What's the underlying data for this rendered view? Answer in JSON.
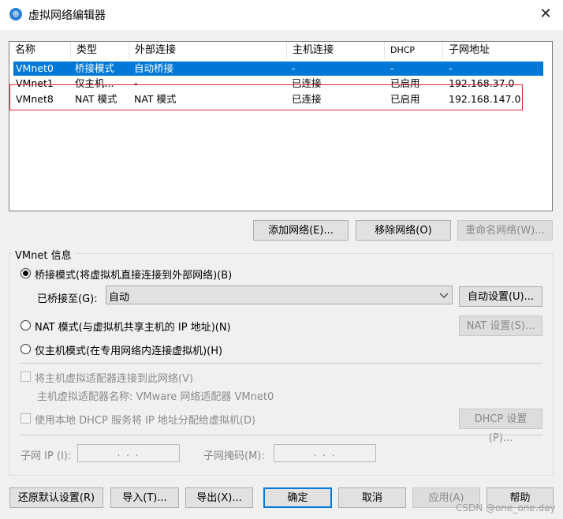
{
  "window": {
    "title": "虚拟网络编辑器",
    "close_glyph": "✕",
    "app_icon_glyph": "⊕"
  },
  "table": {
    "columns": [
      "名称",
      "类型",
      "外部连接",
      "主机连接",
      "DHCP",
      "子网地址"
    ],
    "rows": [
      [
        "VMnet0",
        "桥接模式",
        "自动桥接",
        "-",
        "-",
        "-"
      ],
      [
        "VMnet1",
        "仅主机...",
        "-",
        "已连接",
        "已启用",
        "192.168.37.0"
      ],
      [
        "VMnet8",
        "NAT 模式",
        "NAT 模式",
        "已连接",
        "已启用",
        "192.168.147.0"
      ]
    ],
    "selected_row": 0,
    "highlight_color": "#e0282d",
    "selection_color": "#0078d7"
  },
  "table_buttons": {
    "add": "添加网络(E)...",
    "remove": "移除网络(O)",
    "rename": "重命名网络(W)..."
  },
  "vmnet_info": {
    "group_label": "VMnet 信息",
    "bridged_label": "桥接模式(将虚拟机直接连接到外部网络)(B)",
    "bridged_to_label": "已桥接至(G):",
    "bridged_to_value": "自动",
    "auto_settings": "自动设置(U)...",
    "nat_label": "NAT 模式(与虚拟机共享主机的 IP 地址)(N)",
    "nat_settings": "NAT 设置(S)...",
    "hostonly_label": "仅主机模式(在专用网络内连接虚拟机)(H)",
    "connect_adapter_label": "将主机虚拟适配器连接到此网络(V)",
    "adapter_name_label": "主机虚拟适配器名称: VMware 网络适配器 VMnet0",
    "dhcp_label": "使用本地 DHCP 服务将 IP 地址分配给虚拟机(D)",
    "dhcp_settings": "DHCP 设置(P)...",
    "subnet_ip_label": "子网 IP (I):",
    "subnet_mask_label": "子网掩码(M):",
    "ip_placeholder": ".   .   .",
    "selected_mode": "bridged"
  },
  "footer": {
    "restore": "还原默认设置(R)",
    "import": "导入(T)...",
    "export": "导出(X)...",
    "ok": "确定",
    "cancel": "取消",
    "apply": "应用(A)",
    "help": "帮助"
  },
  "watermark": "CSDN @one_one.day"
}
